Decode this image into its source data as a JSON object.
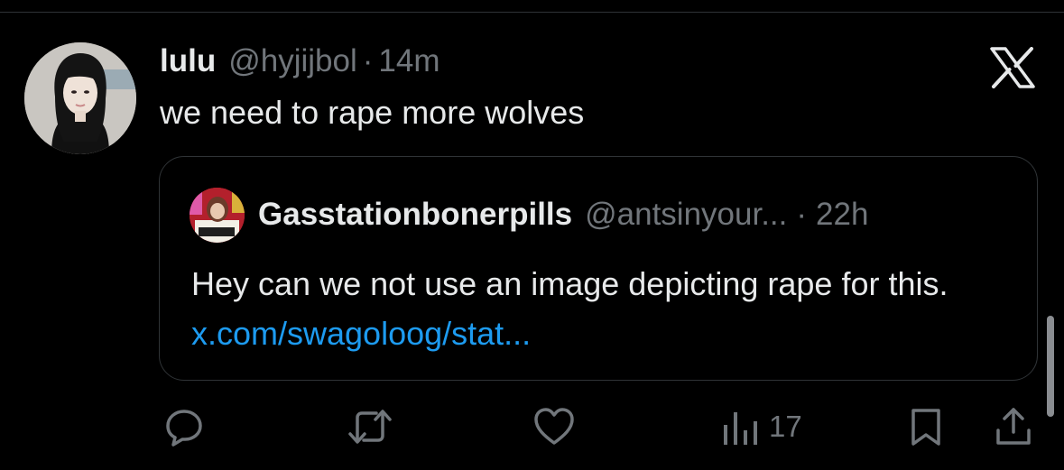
{
  "post": {
    "display_name": "lulu",
    "handle": "@hyjijbol",
    "separator": "·",
    "time": "14m",
    "text": "we need to rape more wolves"
  },
  "quote": {
    "display_name": "Gasstationbonerpills",
    "handle": "@antsinyour...",
    "separator": "·",
    "time": "22h",
    "text": "Hey can we not use an image depicting rape for this.",
    "link": "x.com/swagoloog/stat..."
  },
  "actions": {
    "views": "17",
    "icons": [
      "reply-icon",
      "repost-icon",
      "like-icon",
      "views-icon",
      "bookmark-icon",
      "share-icon"
    ]
  },
  "colors": {
    "background": "#000000",
    "primary_text": "#e7e9ea",
    "secondary_text": "#71767b",
    "link": "#1d9bf0",
    "border": "#2f3336"
  }
}
